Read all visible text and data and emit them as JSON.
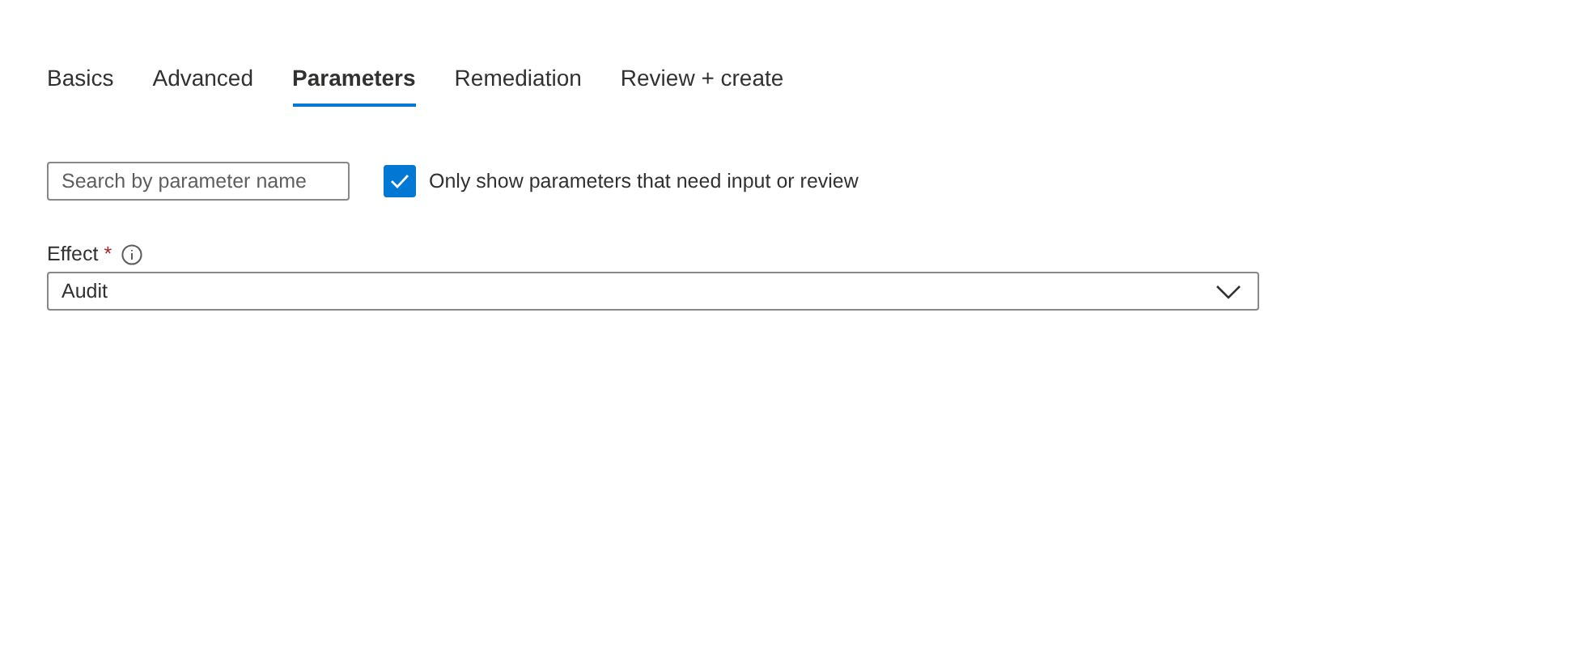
{
  "tabs": [
    {
      "label": "Basics",
      "selected": false
    },
    {
      "label": "Advanced",
      "selected": false
    },
    {
      "label": "Parameters",
      "selected": true
    },
    {
      "label": "Remediation",
      "selected": false
    },
    {
      "label": "Review + create",
      "selected": false
    }
  ],
  "search": {
    "placeholder": "Search by parameter name"
  },
  "filter": {
    "label": "Only show parameters that need input or review",
    "checked": true
  },
  "fields": [
    {
      "label": "Effect",
      "required_mark": "*",
      "value": "Audit"
    }
  ]
}
